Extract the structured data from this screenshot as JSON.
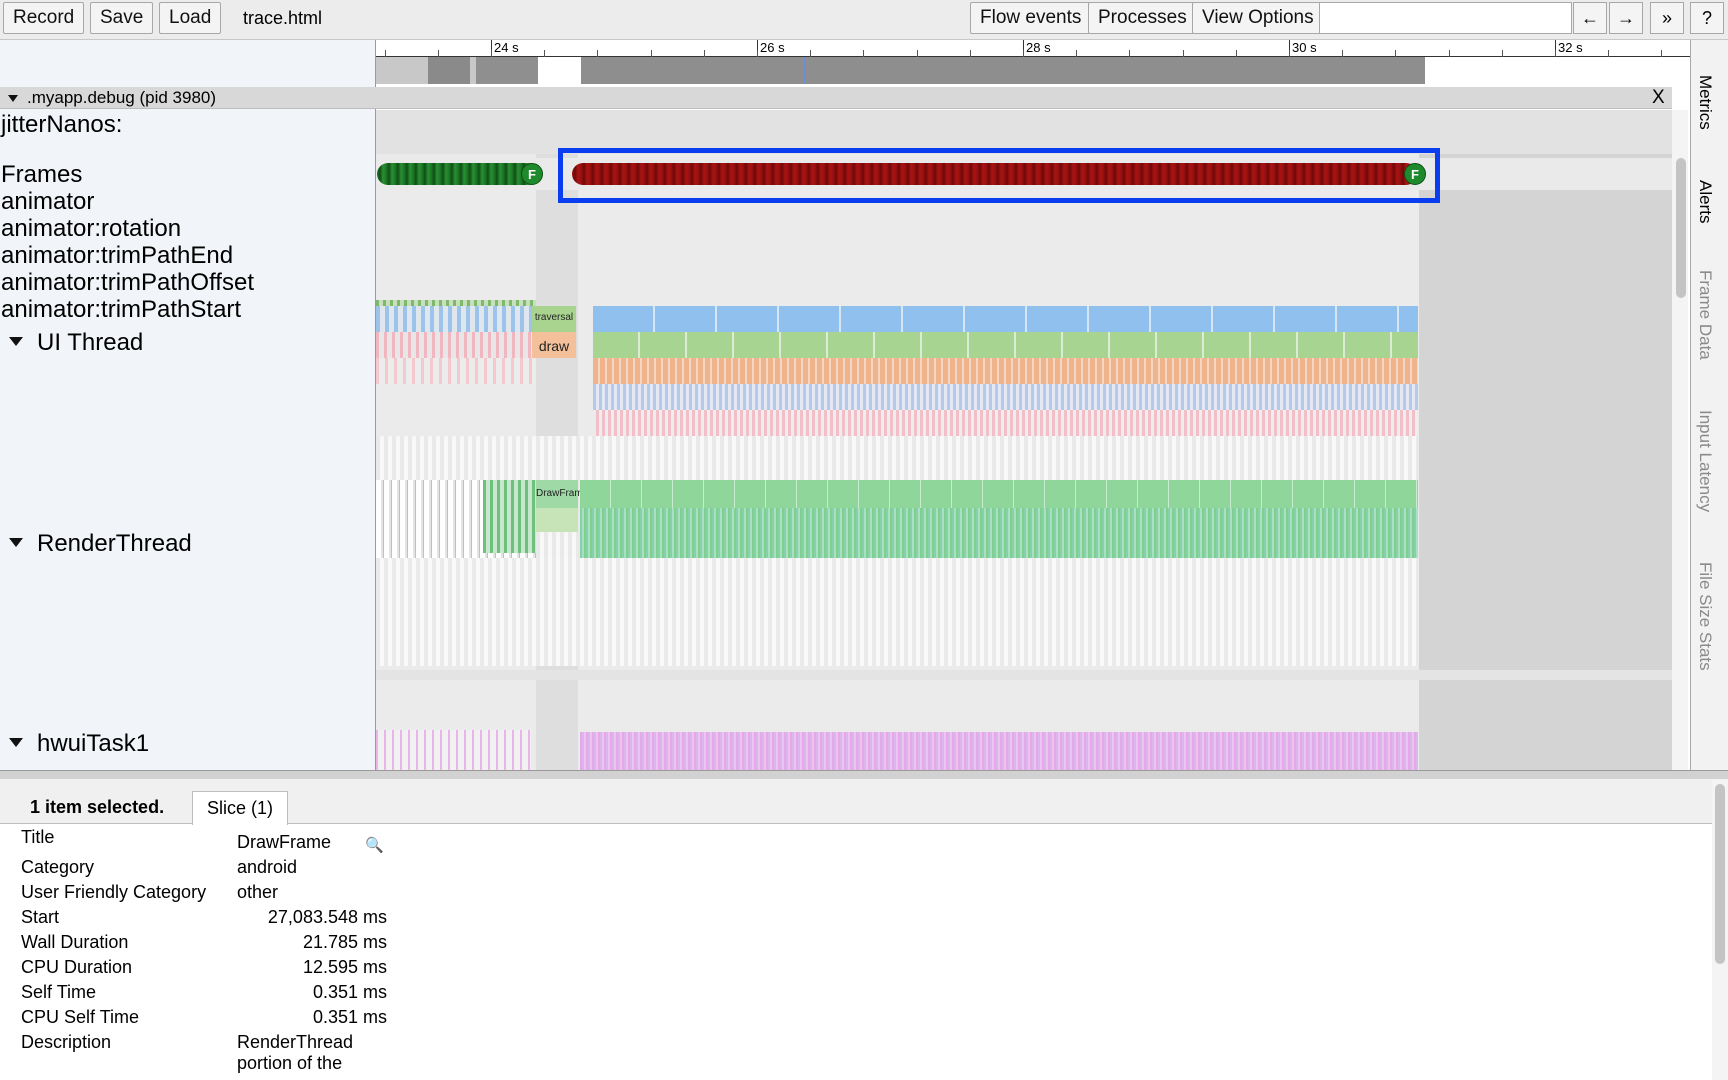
{
  "toolbar": {
    "record": "Record",
    "save": "Save",
    "load": "Load",
    "filename": "trace.html",
    "flow_events": "Flow events",
    "processes": "Processes",
    "view_options": "View Options",
    "back": "←",
    "forward": "→",
    "more": "»",
    "help": "?"
  },
  "ruler": {
    "ticks": [
      "24 s",
      "26 s",
      "28 s",
      "30 s",
      "32 s"
    ]
  },
  "process": {
    "title": ".myapp.debug (pid 3980)",
    "close": "X"
  },
  "tracks": {
    "jitter": "jitterNanos:",
    "frames": "Frames",
    "animator": "animator",
    "rotation": "animator:rotation",
    "trim_end": "animator:trimPathEnd",
    "trim_offset": "animator:trimPathOffset",
    "trim_start": "animator:trimPathStart",
    "ui_thread": "UI Thread",
    "render_thread": "RenderThread",
    "hwui_task": "hwuiTask1"
  },
  "slices": {
    "traversal": "traversal",
    "draw": "draw",
    "drawframe": "DrawFrame",
    "frame_marker": "F"
  },
  "side_tabs": [
    "Metrics",
    "Alerts",
    "Frame Data",
    "Input Latency",
    "File Size Stats"
  ],
  "analysis": {
    "summary": "1 item selected.",
    "tab": "Slice (1)",
    "rows": [
      {
        "key": "Title",
        "value": "DrawFrame"
      },
      {
        "key": "Category",
        "value": "android"
      },
      {
        "key": "User Friendly Category",
        "value": "other"
      },
      {
        "key": "Start",
        "value": "27,083.548 ms"
      },
      {
        "key": "Wall Duration",
        "value": "21.785 ms"
      },
      {
        "key": "CPU Duration",
        "value": "12.595 ms"
      },
      {
        "key": "Self Time",
        "value": "0.351 ms"
      },
      {
        "key": "CPU Self Time",
        "value": "0.351 ms"
      },
      {
        "key": "Description",
        "value": "RenderThread portion of the"
      }
    ]
  },
  "colors": {
    "highlight": "#0a3cf0",
    "frame_good": "#1f8a2c",
    "frame_janky": "#9b1010",
    "traversal": "#8fc0ee",
    "draw": "#9ecf8a",
    "record": "#f0b48c",
    "drawframe": "#8fd69a",
    "hwui": "#e6a8e8"
  }
}
